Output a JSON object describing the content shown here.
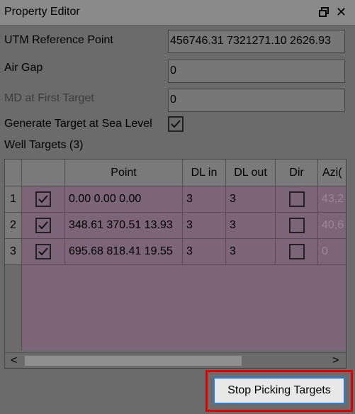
{
  "panel": {
    "title": "Property Editor"
  },
  "fields": {
    "utm_label": "UTM Reference Point",
    "utm_value": "456746.31 7321271.10 2626.93",
    "air_gap_label": "Air Gap",
    "air_gap_value": "0",
    "md_label": "MD at First Target",
    "md_value": "0",
    "generate_label": "Generate Target at Sea Level",
    "generate_checked": true
  },
  "well_targets": {
    "label": "Well Targets (3)",
    "columns": [
      "Point",
      "DL in",
      "DL out",
      "Dir",
      "Azi("
    ],
    "rows": [
      {
        "index": "1",
        "checked": true,
        "point": "0.00 0.00 0.00",
        "dl_in": "3",
        "dl_out": "3",
        "dir": false,
        "azi": "43,2"
      },
      {
        "index": "2",
        "checked": true,
        "point": "348.61 370.51 13.93",
        "dl_in": "3",
        "dl_out": "3",
        "dir": false,
        "azi": "40,6"
      },
      {
        "index": "3",
        "checked": true,
        "point": "695.68 818.41 19.55",
        "dl_in": "3",
        "dl_out": "3",
        "dir": false,
        "azi": "0"
      }
    ]
  },
  "actions": {
    "stop_picking": "Stop Picking Targets"
  },
  "icons": {
    "restore": "restore-icon",
    "close": "close-icon",
    "scroll_left": "chevron-left-icon",
    "scroll_right": "chevron-right-icon"
  },
  "colors": {
    "selection": "#7c6579",
    "highlight": "#e00000",
    "button_focus": "#2a7fd8"
  }
}
